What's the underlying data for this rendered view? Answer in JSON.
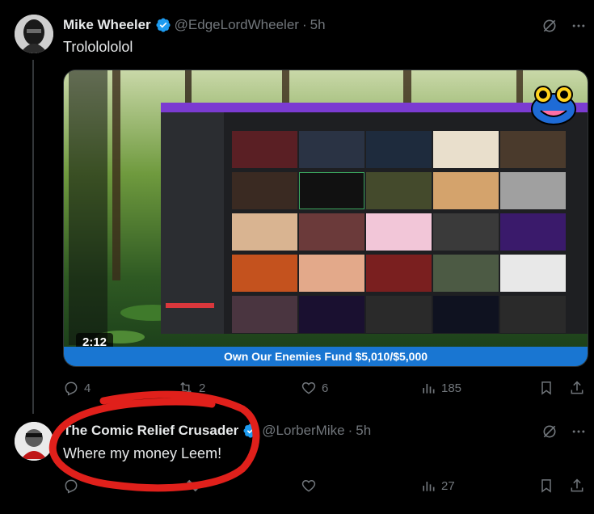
{
  "tweet1": {
    "name": "Mike Wheeler",
    "handle": "@EdgeLordWheeler",
    "separator": "·",
    "time": "5h",
    "text": "Trololololol",
    "video_duration": "2:12",
    "banner_text": "Own Our Enemies Fund $5,010/$5,000",
    "actions": {
      "replies": "4",
      "reposts": "2",
      "likes": "6",
      "views": "185"
    }
  },
  "tweet2": {
    "name": "The Comic Relief Crusader",
    "handle": "@LorberMike",
    "separator": "·",
    "time": "5h",
    "text": "Where my money Leem!",
    "actions": {
      "views": "27"
    }
  },
  "colors": {
    "background": "#000000",
    "text_primary": "#e7e9ea",
    "text_secondary": "#71767b",
    "verified": "#1d9bf0",
    "banner": "#1976d2",
    "annotation": "#e0201b"
  },
  "icons": [
    "grok-icon",
    "more-icon",
    "reply-icon",
    "repost-icon",
    "like-icon",
    "views-icon",
    "bookmark-icon",
    "share-icon",
    "verified-badge-icon"
  ]
}
